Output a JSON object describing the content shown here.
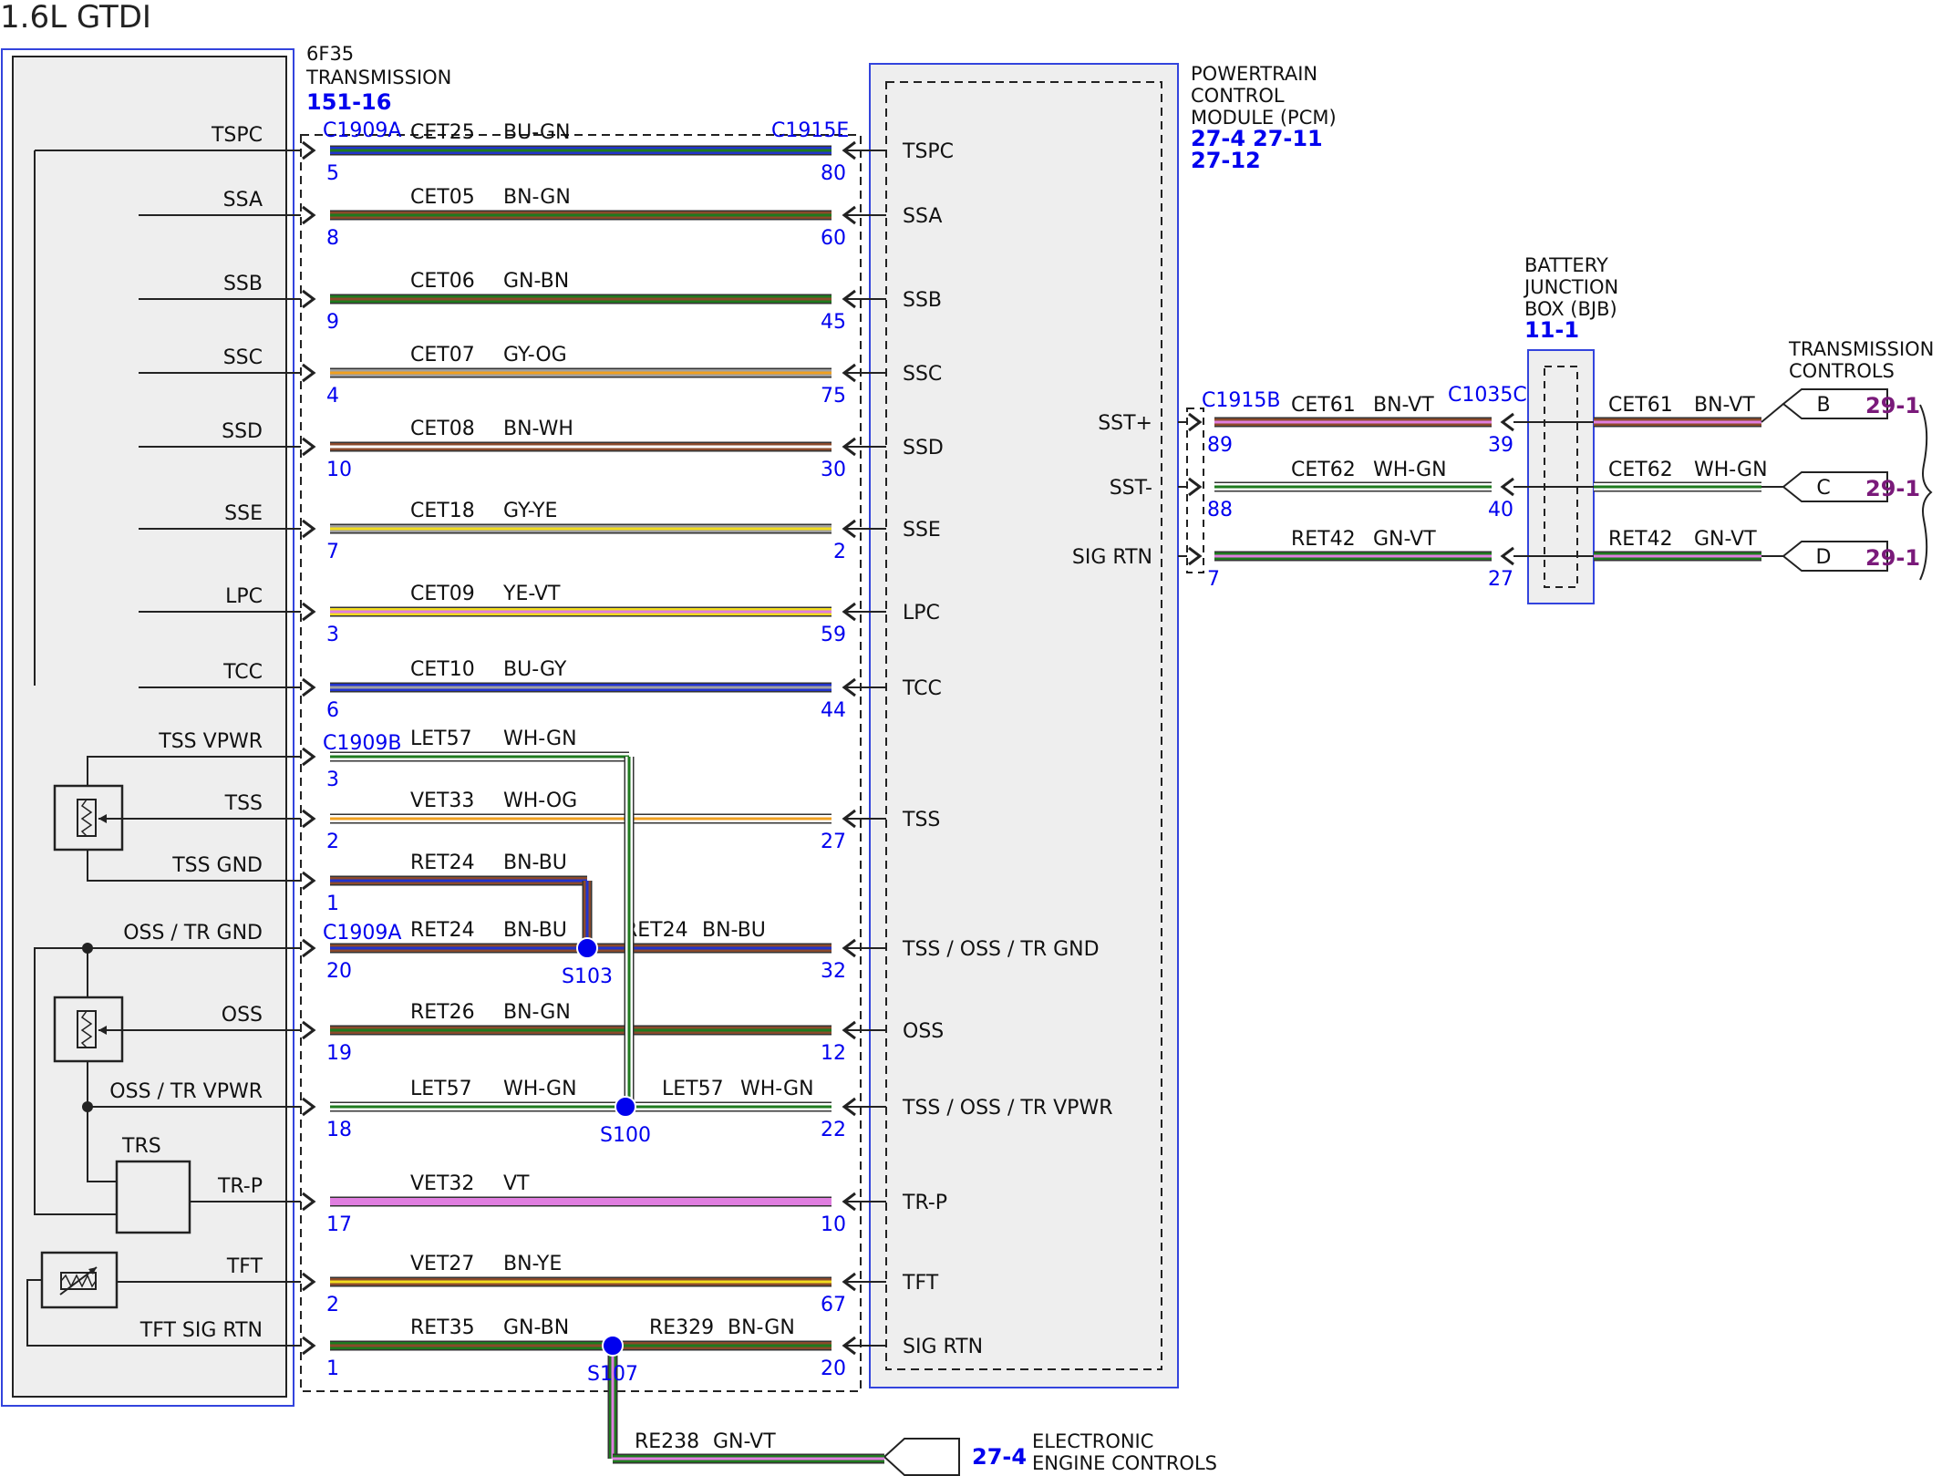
{
  "title": "1.6L GTDI",
  "transmission": {
    "name_line1": "6F35",
    "name_line2": "TRANSMISSION",
    "ref": "151-16",
    "connector_a": "C1909A",
    "connector_b": "C1909B",
    "connector_a2": "C1909A"
  },
  "pcm": {
    "name_line1": "POWERTRAIN",
    "name_line2": "CONTROL",
    "name_line3": "MODULE (PCM)",
    "ref1": "27-4",
    "ref2": "27-11",
    "ref3": "27-12",
    "connector": "C1915E",
    "connector_b": "C1915B"
  },
  "bjb": {
    "name_line1": "BATTERY",
    "name_line2": "JUNCTION",
    "name_line3": "BOX (BJB)",
    "ref": "11-1",
    "connector": "C1035C"
  },
  "trans_controls": {
    "name_line1": "TRANSMISSION",
    "name_line2": "CONTROLS"
  },
  "eec": {
    "ref": "27-4",
    "name_line1": "ELECTRONIC",
    "name_line2": "ENGINE CONTROLS"
  },
  "trs_label": "TRS",
  "wires": [
    {
      "trans_pin": "TSPC",
      "circuit": "CET25",
      "color": "BU-GN",
      "tpin": "5",
      "ppin": "80",
      "pcm_pin": "TSPC"
    },
    {
      "trans_pin": "SSA",
      "circuit": "CET05",
      "color": "BN-GN",
      "tpin": "8",
      "ppin": "60",
      "pcm_pin": "SSA"
    },
    {
      "trans_pin": "SSB",
      "circuit": "CET06",
      "color": "GN-BN",
      "tpin": "9",
      "ppin": "45",
      "pcm_pin": "SSB"
    },
    {
      "trans_pin": "SSC",
      "circuit": "CET07",
      "color": "GY-OG",
      "tpin": "4",
      "ppin": "75",
      "pcm_pin": "SSC"
    },
    {
      "trans_pin": "SSD",
      "circuit": "CET08",
      "color": "BN-WH",
      "tpin": "10",
      "ppin": "30",
      "pcm_pin": "SSD"
    },
    {
      "trans_pin": "SSE",
      "circuit": "CET18",
      "color": "GY-YE",
      "tpin": "7",
      "ppin": "2",
      "pcm_pin": "SSE"
    },
    {
      "trans_pin": "LPC",
      "circuit": "CET09",
      "color": "YE-VT",
      "tpin": "3",
      "ppin": "59",
      "pcm_pin": "LPC"
    },
    {
      "trans_pin": "TCC",
      "circuit": "CET10",
      "color": "BU-GY",
      "tpin": "6",
      "ppin": "44",
      "pcm_pin": "TCC"
    },
    {
      "trans_pin": "TSS VPWR",
      "circuit": "LET57",
      "color": "WH-GN",
      "tpin": "3",
      "ppin": "",
      "pcm_pin": ""
    },
    {
      "trans_pin": "TSS",
      "circuit": "VET33",
      "color": "WH-OG",
      "tpin": "2",
      "ppin": "27",
      "pcm_pin": "TSS"
    },
    {
      "trans_pin": "TSS GND",
      "circuit": "RET24",
      "color": "BN-BU",
      "tpin": "1",
      "ppin": "",
      "pcm_pin": ""
    },
    {
      "trans_pin": "OSS / TR GND",
      "circuit": "RET24",
      "color": "BN-BU",
      "tpin": "20",
      "ppin": "32",
      "pcm_pin": "TSS / OSS / TR GND",
      "circuit2": "RET24",
      "color2": "BN-BU",
      "splice": "S103"
    },
    {
      "trans_pin": "OSS",
      "circuit": "RET26",
      "color": "BN-GN",
      "tpin": "19",
      "ppin": "12",
      "pcm_pin": "OSS"
    },
    {
      "trans_pin": "OSS / TR VPWR",
      "circuit": "LET57",
      "color": "WH-GN",
      "tpin": "18",
      "ppin": "22",
      "pcm_pin": "TSS / OSS / TR VPWR",
      "circuit2": "LET57",
      "color2": "WH-GN",
      "splice": "S100"
    },
    {
      "trans_pin": "TR-P",
      "circuit": "VET32",
      "color": "VT",
      "tpin": "17",
      "ppin": "10",
      "pcm_pin": "TR-P"
    },
    {
      "trans_pin": "TFT",
      "circuit": "VET27",
      "color": "BN-YE",
      "tpin": "2",
      "ppin": "67",
      "pcm_pin": "TFT"
    },
    {
      "trans_pin": "TFT SIG RTN",
      "circuit": "RET35",
      "color": "GN-BN",
      "tpin": "1",
      "ppin": "20",
      "pcm_pin": "SIG RTN",
      "circuit2": "RE329",
      "color2": "BN-GN",
      "splice": "S107"
    }
  ],
  "eec_wire": {
    "circuit": "RE238",
    "color": "GN-VT"
  },
  "bjb_wires": [
    {
      "pcm_pin": "SST+",
      "ppin": "89",
      "circuit": "CET61",
      "color": "BN-VT",
      "bpin": "39",
      "circuit_out": "CET61",
      "color_out": "BN-VT",
      "conn": "B",
      "ref": "29-1"
    },
    {
      "pcm_pin": "SST-",
      "ppin": "88",
      "circuit": "CET62",
      "color": "WH-GN",
      "bpin": "40",
      "circuit_out": "CET62",
      "color_out": "WH-GN",
      "conn": "C",
      "ref": "29-1"
    },
    {
      "pcm_pin": "SIG RTN",
      "ppin": "7",
      "circuit": "RET42",
      "color": "GN-VT",
      "bpin": "27",
      "circuit_out": "RET42",
      "color_out": "GN-VT",
      "conn": "D",
      "ref": "29-1"
    }
  ],
  "wire_colors": {
    "BU": "#2233cc",
    "GN": "#1e7a1e",
    "BN": "#8b4a2b",
    "GY": "#a0a0a0",
    "OG": "#f0a020",
    "WH": "#ffffff",
    "YE": "#f2dc1e",
    "VT": "#e07ee0",
    "link": "#0000ee",
    "ref_purple": "#7a1a7a"
  }
}
